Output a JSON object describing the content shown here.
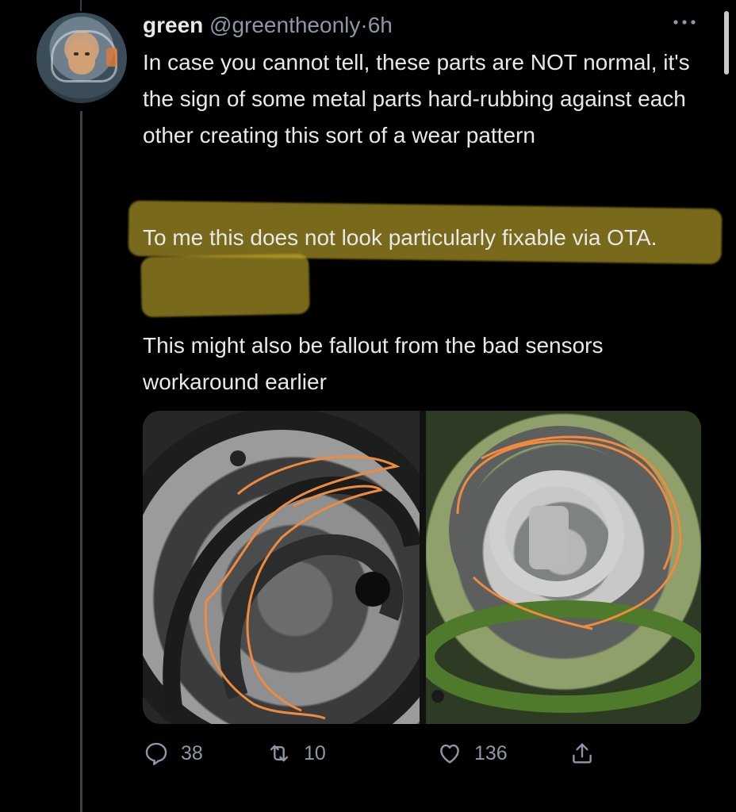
{
  "tweet": {
    "display_name": "green",
    "handle": "@greentheonly",
    "separator": "·",
    "time": "6h",
    "paragraph1": "In case you cannot tell, these parts are NOT normal, it's the sign of some metal parts hard-rubbing against each other creating this sort of a wear pattern",
    "paragraph2": "To me this does not look particularly fixable via OTA.",
    "paragraph3": "This might also be fallout from the bad sensors workaround earlier",
    "more_icon": "more-horizontal-icon"
  },
  "actions": {
    "replies": "38",
    "retweets": "10",
    "likes": "136"
  },
  "colors": {
    "background": "#000000",
    "text": "#e7e9ea",
    "secondary": "#8b98a5",
    "highlight": "#c4aa2a",
    "annotation": "#f08a3c"
  }
}
